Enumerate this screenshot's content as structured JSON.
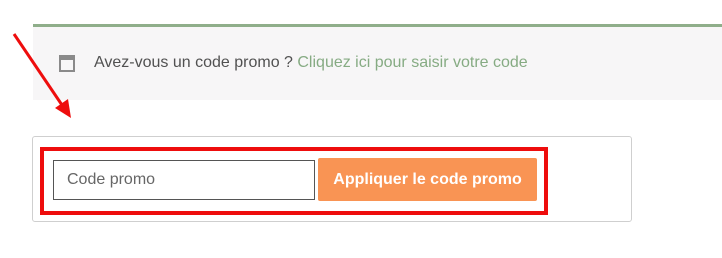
{
  "notice": {
    "text": "Avez-vous un code promo ? ",
    "link_label": "Cliquez ici pour saisir votre code",
    "icon": "calendar-icon"
  },
  "coupon": {
    "input_placeholder": "Code promo",
    "input_value": "",
    "apply_label": "Appliquer le code promo"
  },
  "annotation": {
    "arrow_color": "#ee0d0d",
    "highlight_color": "#ee0d0d"
  },
  "colors": {
    "button_bg": "#f99454",
    "link": "#86ab83",
    "notice_border": "#8fae8a",
    "notice_bg": "#f7f6f7"
  }
}
